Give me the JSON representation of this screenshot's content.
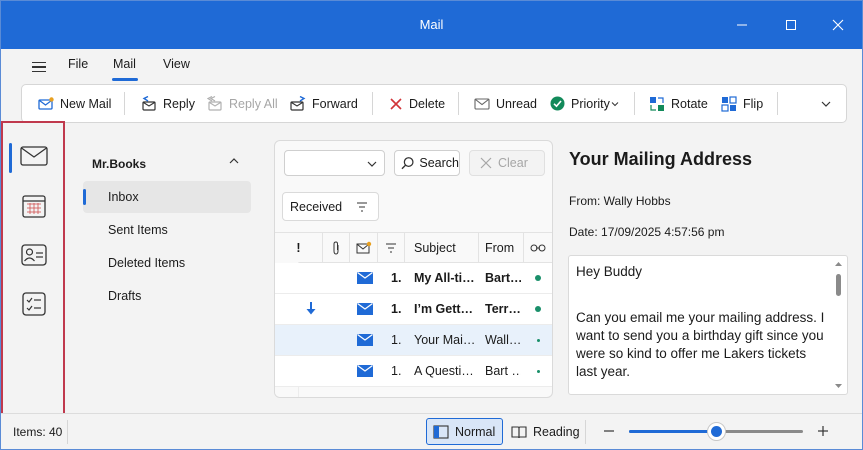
{
  "window": {
    "title": "Mail"
  },
  "menu": {
    "items": [
      "File",
      "Mail",
      "View"
    ],
    "active": "Mail"
  },
  "ribbon": {
    "new_mail": "New Mail",
    "reply": "Reply",
    "reply_all": "Reply All",
    "forward": "Forward",
    "delete": "Delete",
    "unread": "Unread",
    "priority": "Priority",
    "rotate": "Rotate",
    "flip": "Flip"
  },
  "rail": {
    "icons": [
      "mail-icon",
      "calendar-icon",
      "contacts-icon",
      "tasks-icon"
    ],
    "active": "mail-icon"
  },
  "folders": {
    "account": "Mr.Books",
    "items": [
      "Inbox",
      "Sent Items",
      "Deleted Items",
      "Drafts"
    ],
    "selected": "Inbox"
  },
  "list": {
    "search_label": "Search",
    "clear_label": "Clear",
    "sort_label": "Received",
    "columns": {
      "importance": "!",
      "subject": "Subject",
      "from": "From"
    },
    "rows": [
      {
        "num": "1.",
        "subject": "My All-ti…",
        "from": "Bart…",
        "unread": true,
        "flag": false,
        "selected": false
      },
      {
        "num": "1.",
        "subject": "I’m Gett…",
        "from": "Terr…",
        "unread": true,
        "flag": true,
        "selected": false
      },
      {
        "num": "1.",
        "subject": "Your Mai…",
        "from": "Wall…",
        "unread": false,
        "flag": false,
        "selected": true
      },
      {
        "num": "1.",
        "subject": "A Questi…",
        "from": "Bart …",
        "unread": false,
        "flag": false,
        "selected": false
      }
    ]
  },
  "reading": {
    "subject": "Your Mailing Address",
    "from": "From: Wally Hobbs",
    "date": "Date: 17/09/2025 4:57:56 pm",
    "greeting": "Hey Buddy",
    "body": "Can you email me your mailing address. I want to send you a birthday gift since you were so kind to offer me Lakers tickets last year."
  },
  "status": {
    "items": "Items: 40",
    "view_normal": "Normal",
    "view_reading": "Reading",
    "zoom_fraction": 0.5
  },
  "colors": {
    "accent": "#1f6ad6",
    "unread_dot": "#1a8f6a",
    "rail_highlight": "#c0394d"
  }
}
